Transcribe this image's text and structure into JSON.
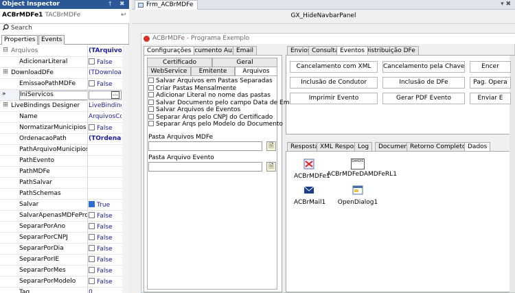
{
  "inspector": {
    "title": "Object Inspector",
    "pin": "†",
    "close": "✖",
    "object_name": "ACBrMDFe1",
    "object_class": "TACBrMDFe",
    "search_placeholder": "Search",
    "tabs": [
      "Properties",
      "Events"
    ],
    "rows": [
      {
        "name": "Arquivos",
        "value": "(TArquivo",
        "expander": "⊟",
        "bold": true,
        "nameGray": true
      },
      {
        "name": "AdicionarLiteral",
        "value": "False",
        "check": "off"
      },
      {
        "name": "DownloadDFe",
        "value": "(TDownloa",
        "expander": "⊞"
      },
      {
        "name": "EmissaoPathMDFe",
        "value": "False",
        "check": "off"
      },
      {
        "name": "IniServicos",
        "value": "",
        "marker": "»",
        "selected": true,
        "ellipsis": "..."
      },
      {
        "name": "LiveBindings Designer",
        "value": "LiveBinding",
        "expander": "⊞"
      },
      {
        "name": "Name",
        "value": "ArquivosCo"
      },
      {
        "name": "NormatizarMunicipios",
        "value": "False",
        "check": "off"
      },
      {
        "name": "OrdenacaoPath",
        "value": "(TOrdenac",
        "bold": true
      },
      {
        "name": "PathArquivoMunicipios",
        "value": ""
      },
      {
        "name": "PathEvento",
        "value": ""
      },
      {
        "name": "PathMDFe",
        "value": ""
      },
      {
        "name": "PathSalvar",
        "value": ""
      },
      {
        "name": "PathSchemas",
        "value": ""
      },
      {
        "name": "Salvar",
        "value": "True",
        "check": "on"
      },
      {
        "name": "SalvarApenasMDFeProcessados",
        "value": "False",
        "check": "off"
      },
      {
        "name": "SepararPorAno",
        "value": "False",
        "check": "off"
      },
      {
        "name": "SepararPorCNPJ",
        "value": "False",
        "check": "off"
      },
      {
        "name": "SepararPorDia",
        "value": "False",
        "check": "off"
      },
      {
        "name": "SepararPorIE",
        "value": "False",
        "check": "off"
      },
      {
        "name": "SepararPorMes",
        "value": "False",
        "check": "off"
      },
      {
        "name": "SepararPorModelo",
        "value": "False",
        "check": "off"
      },
      {
        "name": "Tag",
        "value": "0"
      }
    ]
  },
  "editor": {
    "tab_label": "Frm_ACBrMDFe",
    "nav_panel": "GX_HideNavbarPanel",
    "close_controls": "▾ ✖"
  },
  "form": {
    "title": "ACBrMDFe - Programa Exemplo",
    "left_tabs_row1": [
      "Configurações",
      "Documento Auxiliar",
      "Email"
    ],
    "left_tabs_row2": [
      "Certificado",
      "Geral"
    ],
    "left_tabs_row3": [
      "WebService",
      "Emitente",
      "Arquivos"
    ],
    "checkboxes": [
      "Salvar Arquivos em Pastas Separadas",
      "Criar Pastas Mensalmente",
      "Adicionar Literal no nome das pastas",
      "Salvar Documento pelo campo Data de Emissão",
      "Salvar Arquivos de Eventos",
      "Separar Arqs pelo CNPJ do Certificado",
      "Separar Arqs pelo Modelo do Documento"
    ],
    "pasta_mdfe_label": "Pasta Arquivos MDFe",
    "pasta_evento_label": "Pasta Arquivo Evento",
    "right_tabs": [
      "Envios",
      "Consultas",
      "Eventos",
      "Distribuição DFe"
    ],
    "buttons": [
      [
        "Cancelamento com XML",
        "Cancelamento pela Chave",
        "Encer"
      ],
      [
        "Inclusão de Condutor",
        "Inclusão de DFe",
        "Pag. Opera"
      ],
      [
        "Imprimir Evento",
        "Gerar PDF Evento",
        "Enviar E"
      ]
    ],
    "bottom_tabs": [
      "Respostas",
      "XML Resposta",
      "Log",
      "Documento",
      "Retorno Completo WS",
      "Dados"
    ],
    "components": [
      "ACBrMDFe1",
      "ACBrMDFeDAMDFeRL1",
      "ACBrMail1",
      "OpenDialog1"
    ],
    "component_badge": "DAMDFE"
  }
}
